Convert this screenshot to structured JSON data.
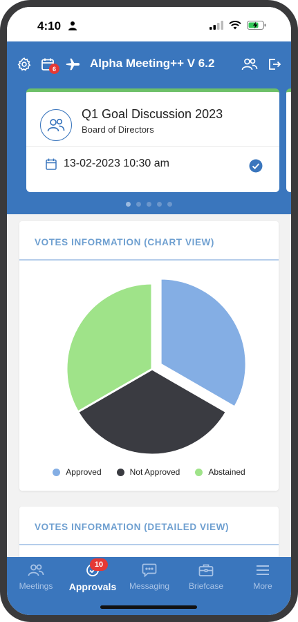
{
  "status_bar": {
    "time": "4:10"
  },
  "header": {
    "title": "Alpha Meeting++ V 6.2",
    "calendar_badge": "6",
    "icons": [
      "gear-icon",
      "calendar-icon",
      "plane-icon",
      "users-icon",
      "logout-icon"
    ]
  },
  "meeting": {
    "title": "Q1 Goal Discussion 2023",
    "subtitle": "Board of Directors",
    "datetime": "13-02-2023 10:30 am"
  },
  "pagination": {
    "count": 5,
    "active_index": 0
  },
  "chart_panel": {
    "title": "VOTES INFORMATION (CHART VIEW)"
  },
  "detail_panel": {
    "title": "VOTES INFORMATION (DETAILED VIEW)"
  },
  "chart_data": {
    "type": "pie",
    "categories": [
      "Approved",
      "Not Approved",
      "Abstained"
    ],
    "values": [
      1,
      1,
      1
    ],
    "colors": [
      "#84aee4",
      "#3a3b41",
      "#9fe389"
    ],
    "exploded": "Approved",
    "legend_position": "bottom"
  },
  "tabs": [
    {
      "label": "Meetings",
      "icon": "meetings-icon",
      "active": false
    },
    {
      "label": "Approvals",
      "icon": "approvals-icon",
      "active": true,
      "badge": "10"
    },
    {
      "label": "Messaging",
      "icon": "messaging-icon",
      "active": false
    },
    {
      "label": "Briefcase",
      "icon": "briefcase-icon",
      "active": false
    },
    {
      "label": "More",
      "icon": "more-icon",
      "active": false
    }
  ]
}
